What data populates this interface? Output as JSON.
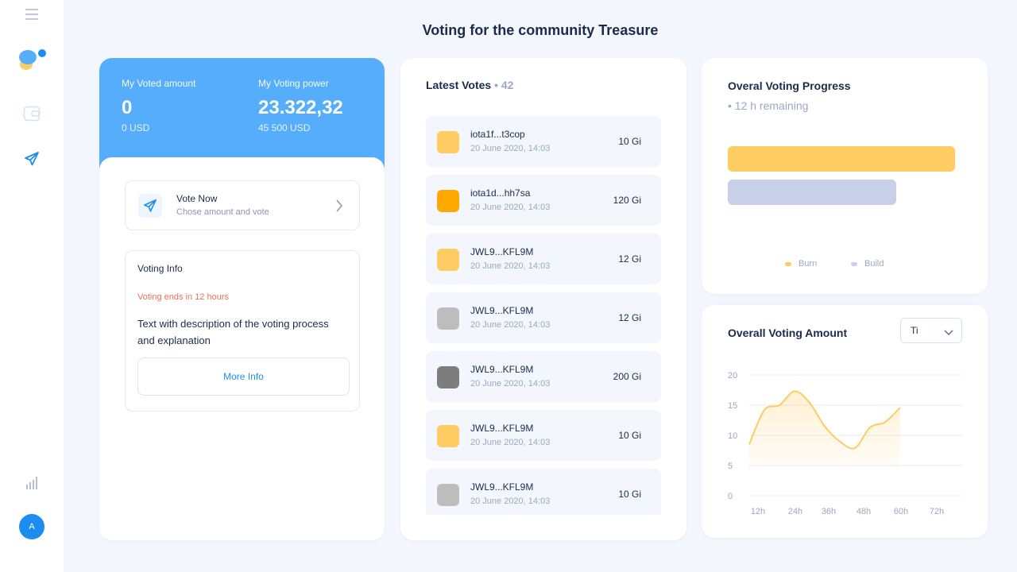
{
  "page": {
    "title": "Voting for the community Treasure"
  },
  "sidebar": {
    "items": [
      {
        "name": "menu-icon",
        "active": false
      },
      {
        "name": "wallet-icon",
        "active": false
      },
      {
        "name": "send-icon",
        "active": true
      },
      {
        "name": "chart-icon",
        "active": false
      }
    ],
    "avatar_initial": "A"
  },
  "summary": {
    "voted_label": "My Voted amount",
    "voted_value": "0",
    "voted_usd": "0 USD",
    "power_label": "My Voting power",
    "power_value": "23.322,32",
    "power_usd": "45 500 USD"
  },
  "vote_now": {
    "title": "Vote Now",
    "subtitle": "Chose amount and vote",
    "icon": "send-icon"
  },
  "voting_info": {
    "title": "Voting Info",
    "warning": "Voting ends in 12 hours",
    "description": "Text with description of the voting process and explanation",
    "button": "More Info"
  },
  "latest_votes": {
    "title": "Latest Votes",
    "count": "• 42",
    "items": [
      {
        "address": "iota1f...t3cop",
        "date": "20 June 2020, 14:03",
        "amount": "10 Gi",
        "color": "#ffcb63"
      },
      {
        "address": "iota1d...hh7sa",
        "date": "20 June 2020, 14:03",
        "amount": "120 Gi",
        "color": "#ffa800"
      },
      {
        "address": "JWL9...KFL9M",
        "date": "20 June 2020, 14:03",
        "amount": "12 Gi",
        "color": "#ffcb63"
      },
      {
        "address": "JWL9...KFL9M",
        "date": "20 June 2020, 14:03",
        "amount": "12 Gi",
        "color": "#bdbdbd"
      },
      {
        "address": "JWL9...KFL9M",
        "date": "20 June 2020, 14:03",
        "amount": "200 Gi",
        "color": "#7d7d7d"
      },
      {
        "address": "JWL9...KFL9M",
        "date": "20 June 2020, 14:03",
        "amount": "10 Gi",
        "color": "#ffcb63"
      },
      {
        "address": "JWL9...KFL9M",
        "date": "20 June 2020, 14:03",
        "amount": "10 Gi",
        "color": "#bdbdbd"
      }
    ]
  },
  "progress": {
    "title": "Overal Voting Progress",
    "subtitle": "• 12 h remaining",
    "bars": [
      {
        "name": "Burn",
        "fraction": 1.0,
        "color": "#ffcb63"
      },
      {
        "name": "Build",
        "fraction": 0.74,
        "color": "#c7d0e8"
      }
    ],
    "legend": [
      "Burn",
      "Build"
    ]
  },
  "amount_chart": {
    "title": "Overall Voting Amount",
    "select_value": "Ti"
  },
  "chart_data": {
    "type": "area",
    "title": "Overall Voting Amount",
    "x": [
      0,
      6,
      12,
      18,
      24,
      30,
      36,
      42,
      48,
      54,
      60
    ],
    "values": [
      8.5,
      14.2,
      15.0,
      17.3,
      15.4,
      11.5,
      9.0,
      7.9,
      11.3,
      12.2,
      14.6
    ],
    "xticks": [
      "12h",
      "24h",
      "36h",
      "48h",
      "60h",
      "72h"
    ],
    "yticks": [
      "20",
      "15",
      "10",
      "5",
      "0"
    ],
    "ylim": [
      0,
      20
    ],
    "grid": true,
    "line_color": "#ffcb63"
  }
}
